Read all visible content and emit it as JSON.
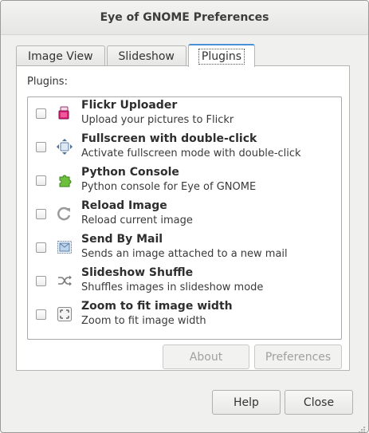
{
  "window": {
    "title": "Eye of GNOME Preferences"
  },
  "tabs": [
    {
      "label": "Image View",
      "active": false
    },
    {
      "label": "Slideshow",
      "active": false
    },
    {
      "label": "Plugins",
      "active": true
    }
  ],
  "plugins_panel": {
    "heading": "Plugins:",
    "items": [
      {
        "name": "Flickr Uploader",
        "description": "Upload your pictures to Flickr",
        "icon": "flickr-icon",
        "checked": false
      },
      {
        "name": "Fullscreen with double-click",
        "description": "Activate fullscreen mode with double-click",
        "icon": "fullscreen-icon",
        "checked": false
      },
      {
        "name": "Python Console",
        "description": "Python console for Eye of GNOME",
        "icon": "puzzle-icon",
        "checked": false
      },
      {
        "name": "Reload Image",
        "description": "Reload current image",
        "icon": "reload-icon",
        "checked": false
      },
      {
        "name": "Send By Mail",
        "description": "Sends an image attached to a new mail",
        "icon": "mail-icon",
        "checked": false
      },
      {
        "name": "Slideshow Shuffle",
        "description": "Shuffles images in slideshow mode",
        "icon": "shuffle-icon",
        "checked": false
      },
      {
        "name": "Zoom to fit image width",
        "description": "Zoom to fit image width",
        "icon": "zoom-fit-icon",
        "checked": false
      }
    ],
    "about_label": "About",
    "preferences_label": "Preferences"
  },
  "footer": {
    "help_label": "Help",
    "close_label": "Close"
  },
  "colors": {
    "accent": "#4a90d9",
    "window_bg": "#f0f0ef",
    "panel_bg": "#ffffff"
  }
}
